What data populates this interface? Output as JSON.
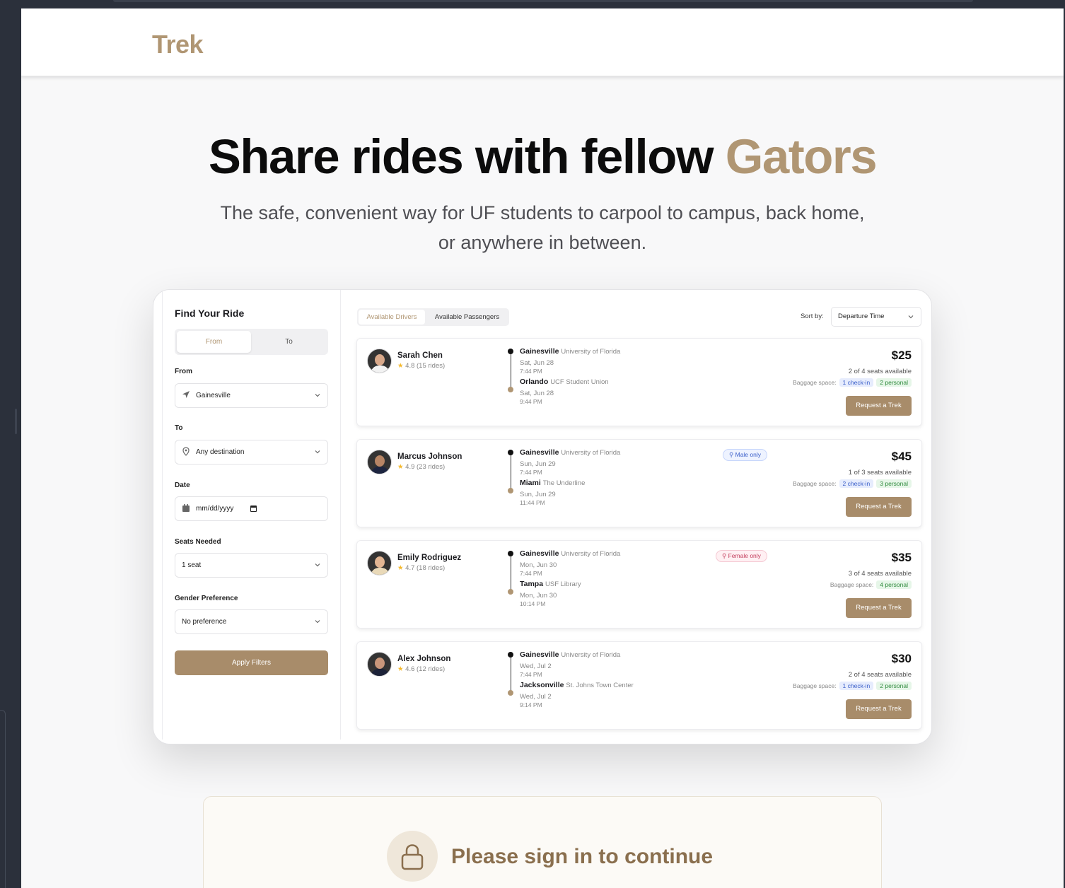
{
  "brand": "Trek",
  "hero": {
    "title_plain": "Share rides with fellow ",
    "title_accent": "Gators",
    "subtitle": "The safe, convenient way for UF students to carpool to campus, back home, or anywhere in between."
  },
  "sidebar": {
    "title": "Find Your Ride",
    "toggle_from": "From",
    "toggle_to": "To",
    "from_label": "From",
    "from_value": "Gainesville",
    "to_label": "To",
    "to_value": "Any destination",
    "date_label": "Date",
    "date_placeholder": "mm/dd/yyyy",
    "seats_label": "Seats Needed",
    "seats_value": "1 seat",
    "gender_label": "Gender Preference",
    "gender_value": "No preference",
    "apply_label": "Apply Filters"
  },
  "main": {
    "tab_drivers": "Available Drivers",
    "tab_passengers": "Available Passengers",
    "sort_label": "Sort by:",
    "sort_value": "Departure Time",
    "baggage_label": "Baggage space:",
    "request_label": "Request a Trek",
    "rides": [
      {
        "name": "Sarah Chen",
        "rating": "4.8 (15 rides)",
        "from_city": "Gainesville",
        "from_place": "University of Florida",
        "from_date": "Sat, Jun 28",
        "from_time": "7:44 PM",
        "to_city": "Orlando",
        "to_place": "UCF Student Union",
        "to_date": "Sat, Jun 28",
        "to_time": "9:44 PM",
        "gender": "",
        "price": "$25",
        "seats": "2 of 4 seats available",
        "checkin": "1 check-in",
        "personal": "2 personal"
      },
      {
        "name": "Marcus Johnson",
        "rating": "4.9 (23 rides)",
        "from_city": "Gainesville",
        "from_place": "University of Florida",
        "from_date": "Sun, Jun 29",
        "from_time": "7:44 PM",
        "to_city": "Miami",
        "to_place": "The Underline",
        "to_date": "Sun, Jun 29",
        "to_time": "11:44 PM",
        "gender": "Male only",
        "price": "$45",
        "seats": "1 of 3 seats available",
        "checkin": "2 check-in",
        "personal": "3 personal"
      },
      {
        "name": "Emily Rodriguez",
        "rating": "4.7 (18 rides)",
        "from_city": "Gainesville",
        "from_place": "University of Florida",
        "from_date": "Mon, Jun 30",
        "from_time": "7:44 PM",
        "to_city": "Tampa",
        "to_place": "USF Library",
        "to_date": "Mon, Jun 30",
        "to_time": "10:14 PM",
        "gender": "Female only",
        "price": "$35",
        "seats": "3 of 4 seats available",
        "checkin": "",
        "personal": "4 personal"
      },
      {
        "name": "Alex Johnson",
        "rating": "4.6 (12 rides)",
        "from_city": "Gainesville",
        "from_place": "University of Florida",
        "from_date": "Wed, Jul 2",
        "from_time": "7:44 PM",
        "to_city": "Jacksonville",
        "to_place": "St. Johns Town Center",
        "to_date": "Wed, Jul 2",
        "to_time": "9:14 PM",
        "gender": "",
        "price": "$30",
        "seats": "2 of 4 seats available",
        "checkin": "1 check-in",
        "personal": "2 personal"
      }
    ]
  },
  "signin": {
    "message": "Please sign in to continue"
  },
  "colors": {
    "accent": "#b09673",
    "button": "#a88c6a"
  }
}
